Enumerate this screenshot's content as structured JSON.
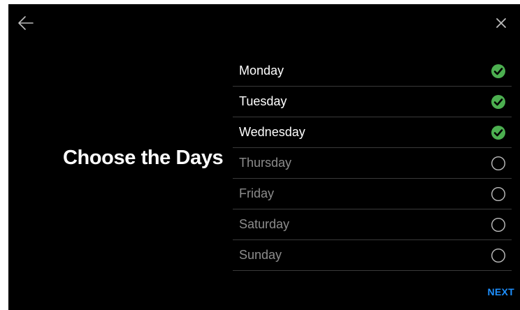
{
  "header": {
    "back_icon": "arrow-left-icon",
    "close_icon": "close-icon"
  },
  "title": "Choose the Days",
  "days": [
    {
      "label": "Monday",
      "checked": true
    },
    {
      "label": "Tuesday",
      "checked": true
    },
    {
      "label": "Wednesday",
      "checked": true
    },
    {
      "label": "Thursday",
      "checked": false
    },
    {
      "label": "Friday",
      "checked": false
    },
    {
      "label": "Saturday",
      "checked": false
    },
    {
      "label": "Sunday",
      "checked": false
    }
  ],
  "footer": {
    "next_label": "NEXT"
  },
  "colors": {
    "background": "#000000",
    "check_green": "#4caf50",
    "accent_blue": "#1e90ff",
    "unchecked_text": "#8c8c8c",
    "divider": "#3a3a3a"
  }
}
